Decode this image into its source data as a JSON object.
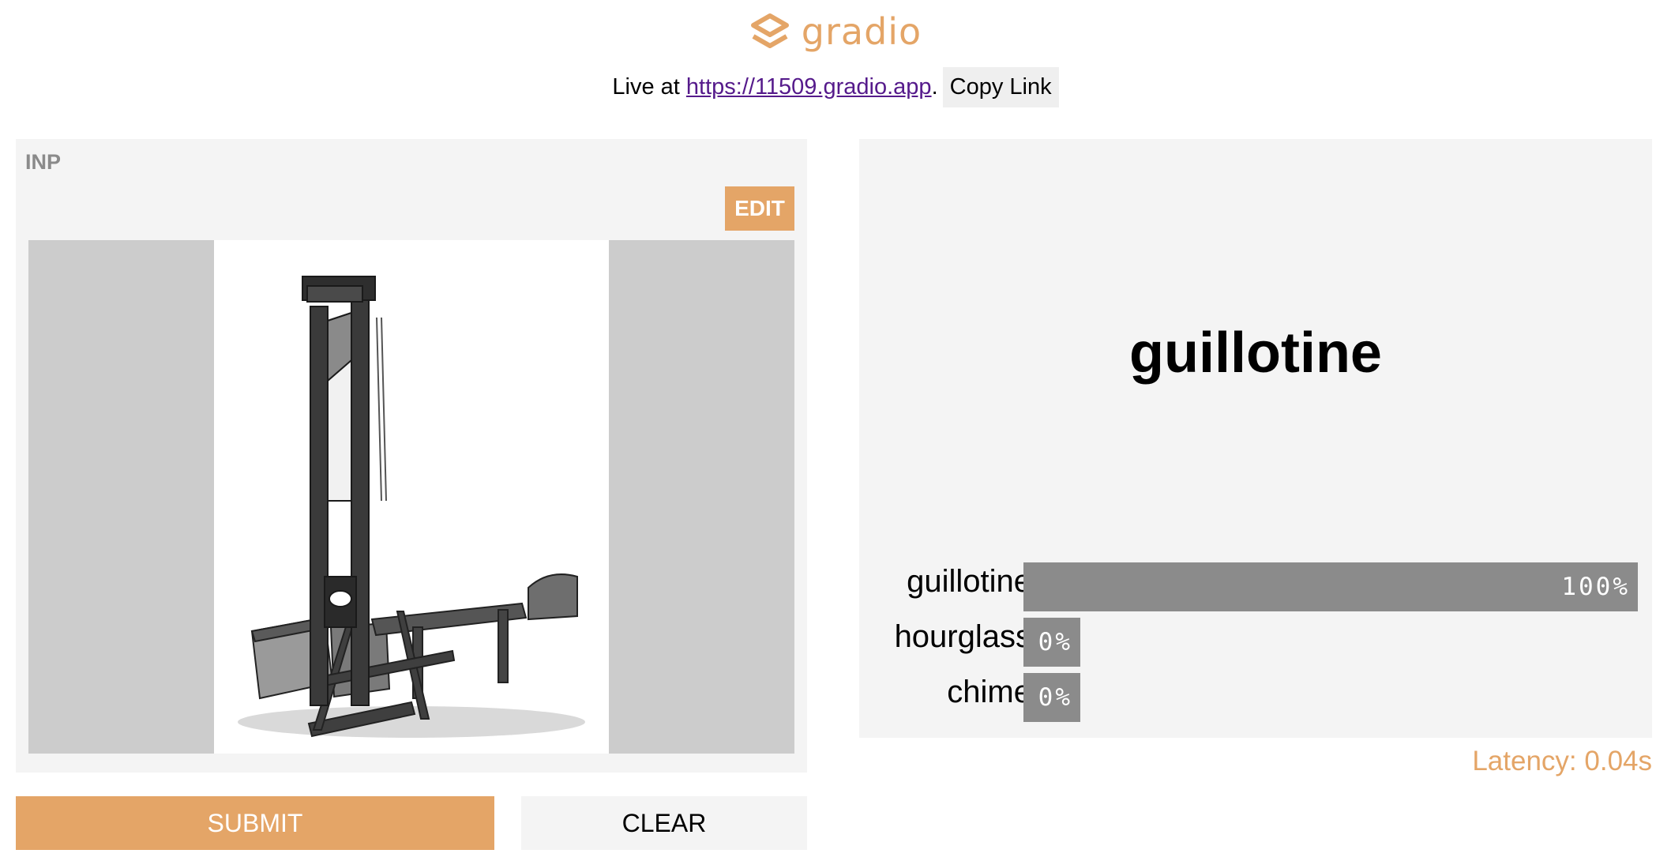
{
  "header": {
    "brand": "gradio",
    "live_prefix": "Live at ",
    "live_url": "https://11509.gradio.app",
    "live_suffix": ".",
    "copy_label": "Copy Link"
  },
  "input": {
    "label": "INP",
    "edit_label": "EDIT"
  },
  "actions": {
    "submit_label": "SUBMIT",
    "clear_label": "CLEAR"
  },
  "output": {
    "label": "guillotine",
    "confidences": [
      {
        "name": "guillotine",
        "value": 1.0,
        "text": "100%"
      },
      {
        "name": "hourglass",
        "value": 0.0,
        "text": "0%"
      },
      {
        "name": "chime",
        "value": 0.0,
        "text": "0%"
      }
    ],
    "latency": "Latency: 0.04s"
  },
  "colors": {
    "accent": "#e4a567",
    "panel": "#f4f4f4",
    "bar": "#8b8b8b"
  }
}
